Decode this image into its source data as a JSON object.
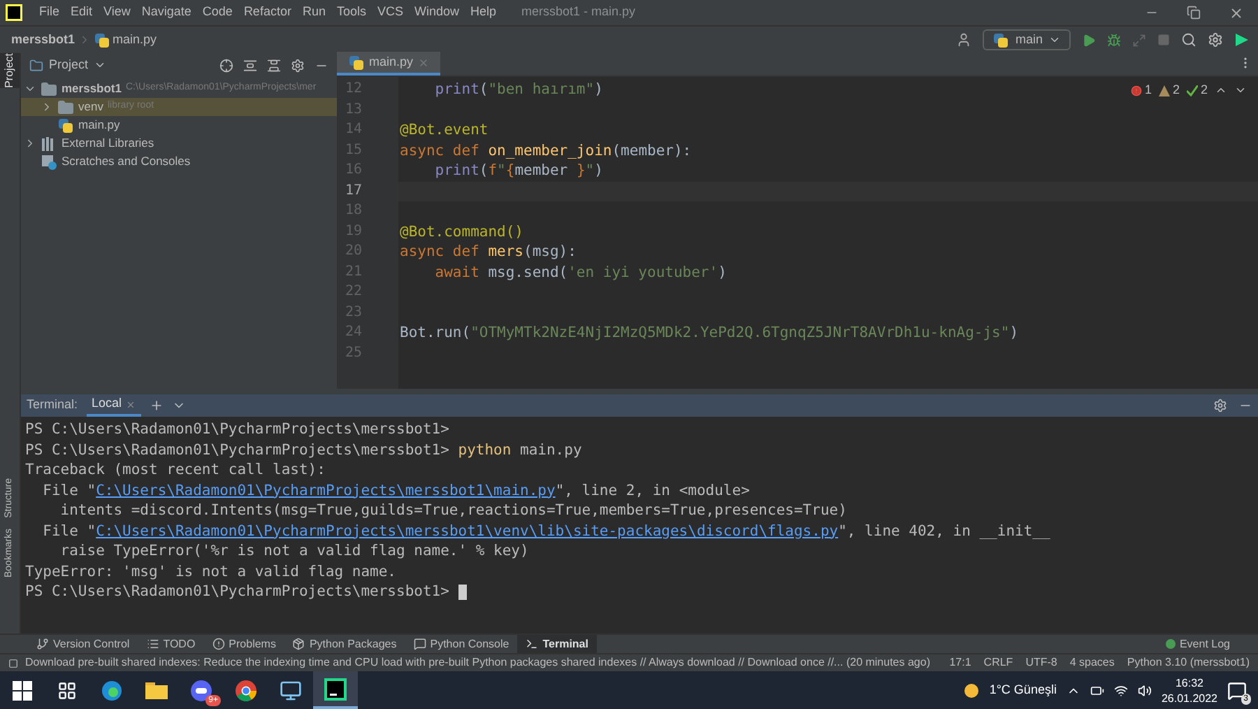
{
  "window": {
    "title": "merssbot1 - main.py"
  },
  "menu": [
    "File",
    "Edit",
    "View",
    "Navigate",
    "Code",
    "Refactor",
    "Run",
    "Tools",
    "VCS",
    "Window",
    "Help"
  ],
  "breadcrumbs": [
    "merssbot1",
    "main.py"
  ],
  "run_config": "main",
  "side_stripe": {
    "top": [
      {
        "label": "Project",
        "selected": true
      }
    ],
    "bottom": [
      {
        "label": "Structure",
        "selected": false
      },
      {
        "label": "Bookmarks",
        "selected": false
      }
    ]
  },
  "project_panel": {
    "title": "Project",
    "tree": [
      {
        "label": "merssbot1",
        "hint": "C:\\Users\\Radamon01\\PycharmProjects\\mer",
        "kind": "folder",
        "bold": true,
        "expanded": true,
        "selected": false,
        "children": [
          {
            "label": "venv",
            "hint": "library root",
            "kind": "folder",
            "expanded": false,
            "selected": true
          },
          {
            "label": "main.py",
            "kind": "python",
            "selected": false
          }
        ]
      },
      {
        "label": "External Libraries",
        "kind": "library",
        "expanded": false,
        "selected": false
      },
      {
        "label": "Scratches and Consoles",
        "kind": "scratch",
        "selected": false
      }
    ]
  },
  "editor": {
    "tabs": [
      {
        "label": "main.py",
        "selected": true
      }
    ],
    "inspections": [
      {
        "kind": "error",
        "count": "1"
      },
      {
        "kind": "warning",
        "count": "2"
      },
      {
        "kind": "typo",
        "count": "2"
      }
    ],
    "lines": [
      {
        "number": "12",
        "current": false,
        "indent": true,
        "tokens": [
          {
            "kind": "builtin",
            "text": "print"
          },
          {
            "kind": "plain",
            "text": "("
          },
          {
            "kind": "string",
            "text": "\"ben haırım\""
          },
          {
            "kind": "plain",
            "text": ")"
          }
        ]
      },
      {
        "number": "13",
        "current": false
      },
      {
        "number": "14",
        "current": false,
        "tokens": [
          {
            "kind": "deco",
            "text": "@Bot.event"
          }
        ]
      },
      {
        "number": "15",
        "current": false,
        "tokens": [
          {
            "kind": "keyword",
            "text": "async def "
          },
          {
            "kind": "func",
            "text": "on_member_join"
          },
          {
            "kind": "plain",
            "text": "(member):"
          }
        ]
      },
      {
        "number": "16",
        "current": false,
        "indent": true,
        "tokens": [
          {
            "kind": "builtin",
            "text": "print"
          },
          {
            "kind": "plain",
            "text": "("
          },
          {
            "kind": "keyword",
            "text": "f"
          },
          {
            "kind": "string",
            "text": "\""
          },
          {
            "kind": "keyword",
            "text": "{"
          },
          {
            "kind": "plain",
            "text": "member "
          },
          {
            "kind": "keyword",
            "text": "}"
          },
          {
            "kind": "string",
            "text": "\""
          },
          {
            "kind": "plain",
            "text": ")"
          }
        ]
      },
      {
        "number": "17",
        "current": true
      },
      {
        "number": "18",
        "current": false
      },
      {
        "number": "19",
        "current": false,
        "tokens": [
          {
            "kind": "deco",
            "text": "@Bot.command()"
          }
        ]
      },
      {
        "number": "20",
        "current": false,
        "tokens": [
          {
            "kind": "keyword",
            "text": "async def "
          },
          {
            "kind": "func",
            "text": "mers"
          },
          {
            "kind": "plain",
            "text": "(msg):"
          }
        ]
      },
      {
        "number": "21",
        "current": false,
        "indent": true,
        "tokens": [
          {
            "kind": "keyword",
            "text": "await"
          },
          {
            "kind": "plain",
            "text": " msg.send("
          },
          {
            "kind": "string",
            "text": "'en iyi youtuber'"
          },
          {
            "kind": "plain",
            "text": ")"
          }
        ]
      },
      {
        "number": "22",
        "current": false
      },
      {
        "number": "23",
        "current": false
      },
      {
        "number": "24",
        "current": false,
        "tokens": [
          {
            "kind": "plain",
            "text": "Bot.run("
          },
          {
            "kind": "string",
            "text": "\"OTMyMTk2NzE4NjI2MzQ5MDk2.YePd2Q.6TgnqZ5JNrT8AVrDh1u-knAg-js\""
          },
          {
            "kind": "plain",
            "text": ")"
          }
        ]
      },
      {
        "number": "25",
        "current": false
      }
    ]
  },
  "terminal": {
    "label": "Terminal:",
    "tabs": [
      {
        "label": "Local",
        "selected": true
      }
    ],
    "lines": [
      [
        {
          "kind": "plain",
          "text": "PS C:\\Users\\Radamon01\\PycharmProjects\\merssbot1>"
        }
      ],
      [
        {
          "kind": "plain",
          "text": "PS C:\\Users\\Radamon01\\PycharmProjects\\merssbot1> "
        },
        {
          "kind": "command",
          "text": "python"
        },
        {
          "kind": "plain",
          "text": " main.py"
        }
      ],
      [
        {
          "kind": "plain",
          "text": "Traceback (most recent call last):"
        }
      ],
      [
        {
          "kind": "plain",
          "text": "  File \""
        },
        {
          "kind": "link",
          "text": "C:\\Users\\Radamon01\\PycharmProjects\\merssbot1\\main.py"
        },
        {
          "kind": "plain",
          "text": "\", line 2, in <module>"
        }
      ],
      [
        {
          "kind": "plain",
          "text": "    intents =discord.Intents(msg=True,guilds=True,reactions=True,members=True,presences=True)"
        }
      ],
      [
        {
          "kind": "plain",
          "text": "  File \""
        },
        {
          "kind": "link",
          "text": "C:\\Users\\Radamon01\\PycharmProjects\\merssbot1\\venv\\lib\\site-packages\\discord\\flags.py"
        },
        {
          "kind": "plain",
          "text": "\", line 402, in __init__"
        }
      ],
      [
        {
          "kind": "plain",
          "text": "    raise TypeError('%r is not a valid flag name.' % key)"
        }
      ],
      [
        {
          "kind": "plain",
          "text": "TypeError: 'msg' is not a valid flag name."
        }
      ],
      [
        {
          "kind": "plain",
          "text": "PS C:\\Users\\Radamon01\\PycharmProjects\\merssbot1> "
        },
        {
          "kind": "cursor"
        }
      ]
    ]
  },
  "tool_windows": [
    {
      "label": "Version Control",
      "kind": "vcs",
      "selected": false
    },
    {
      "label": "TODO",
      "kind": "todo",
      "selected": false
    },
    {
      "label": "Problems",
      "kind": "problems",
      "selected": false
    },
    {
      "label": "Python Packages",
      "kind": "packages",
      "selected": false
    },
    {
      "label": "Python Console",
      "kind": "console",
      "selected": false
    },
    {
      "label": "Terminal",
      "kind": "terminal",
      "selected": true
    }
  ],
  "event_log": "Event Log",
  "status_bar": {
    "message": "Download pre-built shared indexes: Reduce the indexing time and CPU load with pre-built Python packages shared indexes // Always download // Download once //... (20 minutes ago)",
    "items": [
      "17:1",
      "CRLF",
      "UTF-8",
      "4 spaces",
      "Python 3.10 (merssbot1)"
    ]
  },
  "taskbar": {
    "apps": [
      {
        "kind": "start",
        "active": false
      },
      {
        "kind": "taskview",
        "active": false
      },
      {
        "kind": "edge",
        "active": false
      },
      {
        "kind": "explorer",
        "active": false
      },
      {
        "kind": "chat",
        "active": false,
        "badge": "9+"
      },
      {
        "kind": "chrome",
        "active": false
      },
      {
        "kind": "app",
        "active": false
      },
      {
        "kind": "pycharm",
        "active": true
      }
    ],
    "weather": "1°C Güneşli",
    "time": "16:32",
    "date": "26.01.2022",
    "notifications": "3"
  }
}
